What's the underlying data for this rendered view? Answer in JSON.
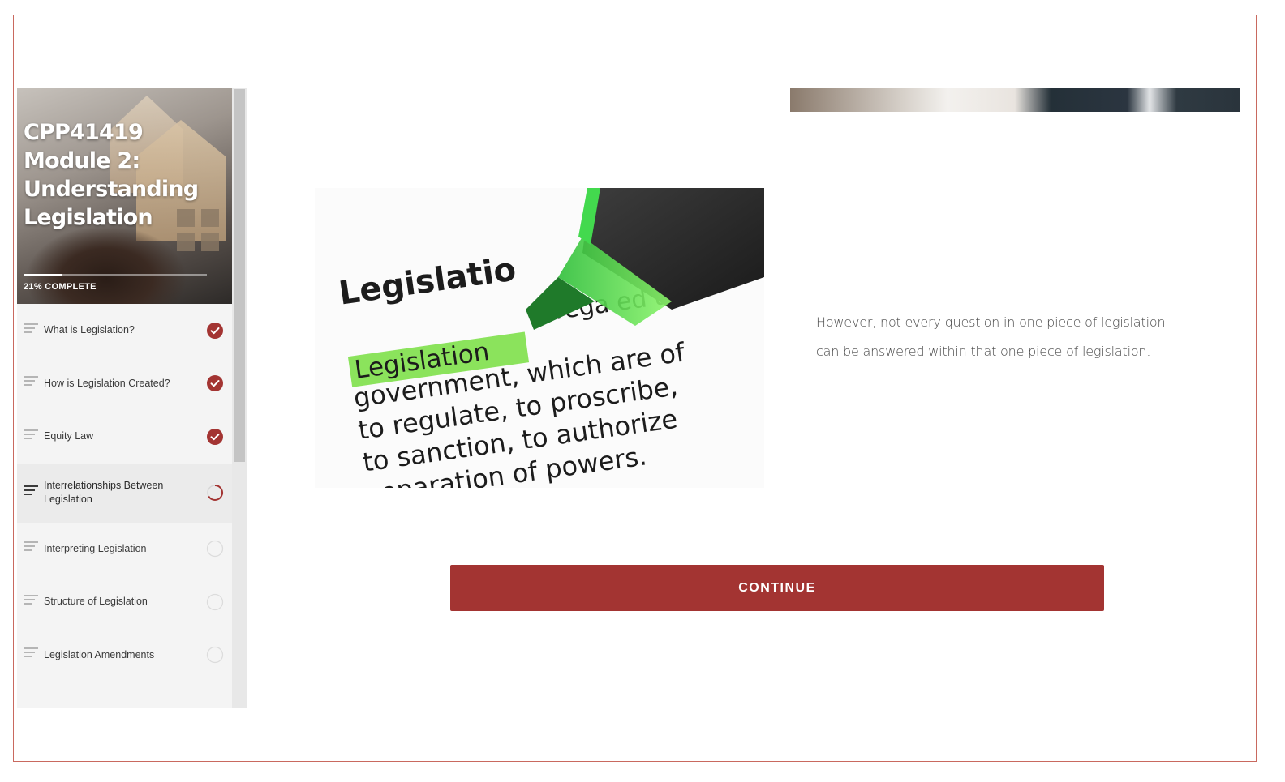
{
  "course": {
    "title": "CPP41419 Module 2: Understanding Legislation",
    "progress_percent": 21,
    "progress_label": "21% COMPLETE"
  },
  "lessons": [
    {
      "label": "What is Legislation?",
      "status": "complete"
    },
    {
      "label": "How is Legislation Created?",
      "status": "complete"
    },
    {
      "label": "Equity Law",
      "status": "complete"
    },
    {
      "label": "Interrelationships Between Legislation",
      "status": "in-progress"
    },
    {
      "label": "Interpreting Legislation",
      "status": "not-started"
    },
    {
      "label": "Structure of Legislation",
      "status": "not-started"
    },
    {
      "label": "Legislation Amendments",
      "status": "not-started"
    }
  ],
  "main": {
    "image": {
      "heading_word": "Legislatio",
      "highlighted_word": "Legislation",
      "text_lines": [
        "rega  ed as",
        "government, which are of",
        "to regulate, to proscribe,",
        "to sanction, to authorize",
        "separation of powers."
      ]
    },
    "body_text": "However, not every question in one piece of legislation can be answered within that one piece of legislation.",
    "continue_label": "CONTINUE"
  },
  "colors": {
    "accent": "#a33432",
    "frame_border": "#c9695f",
    "highlight": "#7ee04a"
  },
  "icons": {
    "lesson": "lines-icon",
    "complete": "check-circle-icon",
    "in_progress": "progress-ring-icon",
    "not_started": "empty-circle-icon"
  }
}
